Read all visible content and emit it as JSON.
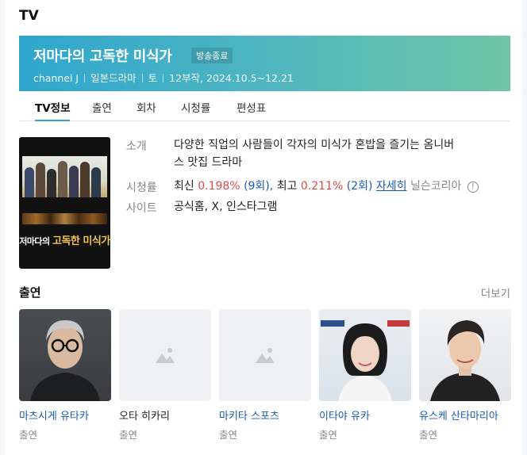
{
  "section_title": "TV",
  "banner": {
    "title": "저마다의 고독한 미식가",
    "badge": "방송종료",
    "meta": [
      "channel J",
      "일본드라마",
      "토",
      "12부작, 2024.10.5~12.21"
    ],
    "colors": {
      "start": "#2fa6cf",
      "end": "#6fc6a6"
    }
  },
  "tabs": [
    "TV정보",
    "출연",
    "회차",
    "시청률",
    "편성표"
  ],
  "active_tab": "TV정보",
  "poster": {
    "title_prefix": "저마다의",
    "title_main": "고독한 미식가"
  },
  "info": {
    "intro_label": "소개",
    "intro_line1": "다양한 직업의 사람들이 각자의 미식가 혼밥을 즐기는 옴니버",
    "intro_line2": "스 맛집 드라마",
    "rating_label": "시청률",
    "rating_latest_text": "최신",
    "rating_latest": "0.198%",
    "rating_latest_ep": "(9회),",
    "rating_best_text": "최고",
    "rating_best": "0.211%",
    "rating_best_ep": "(2회)",
    "rating_detail": "자세히",
    "rating_source": "닐슨코리아",
    "rating_info_icon": "!",
    "site_label": "사이트",
    "site_links": "공식홈, X, 인스타그램"
  },
  "cast": {
    "title": "출연",
    "more": "더보기",
    "members": [
      {
        "name": "마츠시게 유타카",
        "role": "출연",
        "has_photo": true,
        "linked": true
      },
      {
        "name": "오타 히카리",
        "role": "출연",
        "has_photo": false,
        "linked": false
      },
      {
        "name": "마키타 스포츠",
        "role": "출연",
        "has_photo": false,
        "linked": true
      },
      {
        "name": "이타야 유카",
        "role": "출연",
        "has_photo": true,
        "linked": true
      },
      {
        "name": "유스케 산타마리아",
        "role": "출연",
        "has_photo": true,
        "linked": true
      }
    ]
  }
}
